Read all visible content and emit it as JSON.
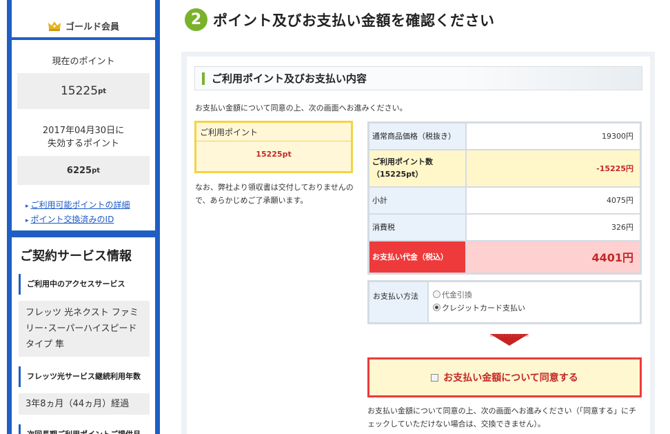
{
  "sidebar": {
    "member_badge": "ゴールド会員",
    "points_title": "現在のポイント",
    "points_value": "15225",
    "points_unit": "pt",
    "expire_title_line1": "2017年04月30日に",
    "expire_title_line2": "失効するポイント",
    "expire_value": "6225",
    "expire_unit": "pt",
    "links": [
      "ご利用可能ポイントの詳細",
      "ポイント交換済みのID"
    ],
    "service_title": "ご契約サービス情報",
    "access_heading": "ご利用中のアクセスサービス",
    "access_value": "フレッツ 光ネクスト ファミリー･スーパーハイスピードタイプ 隼",
    "years_heading": "フレッツ光サービス継続利用年数",
    "years_value": "3年8ヵ月（44ヵ月）経過",
    "next_heading": "次回長期ご利用ポイントご提供月"
  },
  "main": {
    "step_number": "2",
    "title": "ポイント及びお支払い金額を確認ください",
    "section_heading": "ご利用ポイント及びお支払い内容",
    "intro": "お支払い金額について同意の上、次の画面へお進みください。",
    "used_points_label": "ご利用ポイント",
    "used_points_value": "15225pt",
    "note": "なお、弊社より領収書は交付しておりませんので、あらかじめご了承願います。",
    "summary": {
      "normal_price_label": "通常商品価格（税抜き）",
      "normal_price_value": "19300円",
      "used_points_label_line1": "ご利用ポイント数",
      "used_points_label_line2": "（15225pt）",
      "used_points_value": "-15225円",
      "subtotal_label": "小計",
      "subtotal_value": "4075円",
      "tax_label": "消費税",
      "tax_value": "326円",
      "total_label": "お支払い代金（税込）",
      "total_value": "4401円"
    },
    "payment": {
      "label": "お支払い方法",
      "options": [
        "代金引換",
        "クレジットカード支払い"
      ],
      "selected": "クレジットカード支払い"
    },
    "agree_label": "お支払い金額について同意する",
    "agree_checked": false,
    "agree_note": "お支払い金額について同意の上、次の画面へお進みください（「同意する」にチェックしていただけない場合は、交換できません）。"
  },
  "colors": {
    "sidebar_blue": "#1f5fc4",
    "step_green": "#7ab22b",
    "alert_red": "#ee3a3a",
    "highlight_yellow": "#fff7c9",
    "label_blue": "#e9f2fb"
  }
}
